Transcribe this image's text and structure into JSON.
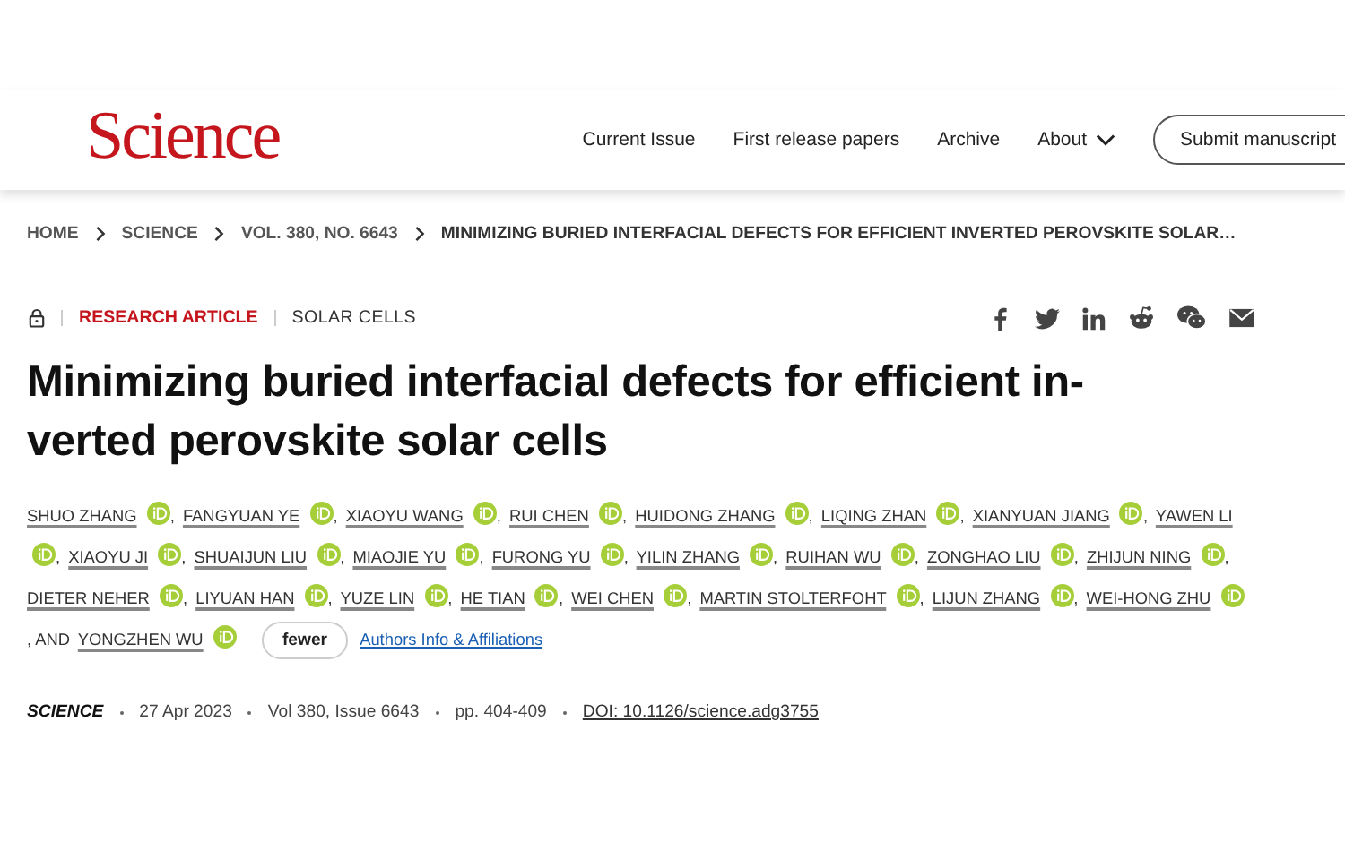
{
  "header": {
    "logo": "Science",
    "nav": [
      {
        "label": "Current Issue",
        "dropdown": false
      },
      {
        "label": "First release papers",
        "dropdown": false
      },
      {
        "label": "Archive",
        "dropdown": false
      },
      {
        "label": "About",
        "dropdown": true
      }
    ],
    "submit_button": "Submit manuscript"
  },
  "breadcrumb": [
    "HOME",
    "SCIENCE",
    "VOL. 380, NO. 6643",
    "MINIMIZING BURIED INTERFACIAL DEFECTS FOR EFFICIENT INVERTED PEROVSKITE SOLAR…"
  ],
  "article": {
    "locked": true,
    "type": "RESEARCH ARTICLE",
    "section": "SOLAR CELLS",
    "share": [
      {
        "kind": "facebook"
      },
      {
        "kind": "twitter"
      },
      {
        "kind": "linkedin"
      },
      {
        "kind": "reddit"
      },
      {
        "kind": "wechat"
      },
      {
        "kind": "email"
      }
    ],
    "title": "Minimizing buried interfacial defects for efficient in-verted perovskite solar cells",
    "authors": [
      {
        "name": "SHUO ZHANG"
      },
      {
        "lead": ",",
        "name": "FANGYUAN YE"
      },
      {
        "lead": ",",
        "name": "XIAOYU WANG"
      },
      {
        "lead": ",",
        "name": "RUI CHEN"
      },
      {
        "lead": ",",
        "name": "HUIDONG ZHANG"
      },
      {
        "lead": ",",
        "name": "LIQING ZHAN"
      },
      {
        "lead": ",",
        "name": "XIANYUAN JIANG"
      },
      {
        "lead": ",",
        "name": "YAWEN LI"
      },
      {
        "lead": ",",
        "name": "XIAOYU JI"
      },
      {
        "lead": ",",
        "name": "SHUAIJUN LIU"
      },
      {
        "lead": ",",
        "name": "MIAOJIE YU"
      },
      {
        "lead": ",",
        "name": "FURONG YU"
      },
      {
        "lead": ",",
        "name": "YILIN ZHANG"
      },
      {
        "lead": ",",
        "name": "RUIHAN WU"
      },
      {
        "lead": ",",
        "name": "ZONGHAO LIU"
      },
      {
        "lead": ",",
        "name": "ZHIJUN NING"
      },
      {
        "lead": ",",
        "name": "DIETER NEHER"
      },
      {
        "lead": ",",
        "name": "LIYUAN HAN"
      },
      {
        "lead": ",",
        "name": "YUZE LIN"
      },
      {
        "lead": ",",
        "name": "HE TIAN"
      },
      {
        "lead": ",",
        "name": "WEI CHEN"
      },
      {
        "lead": ",",
        "name": "MARTIN STOLTERFOHT"
      },
      {
        "lead": ",",
        "name": "LIJUN ZHANG"
      },
      {
        "lead": ",",
        "name": "WEI-HONG ZHU"
      },
      {
        "lead": ", AND",
        "name": "YONGZHEN WU"
      }
    ],
    "fewer_button": "fewer",
    "affiliations_link": "Authors Info & Affiliations",
    "meta": {
      "journal": "SCIENCE",
      "date": "27 Apr 2023",
      "volume": "Vol 380, Issue 6643",
      "pages": "pp. 404-409",
      "doi": "DOI: 10.1126/science.adg3755"
    }
  }
}
